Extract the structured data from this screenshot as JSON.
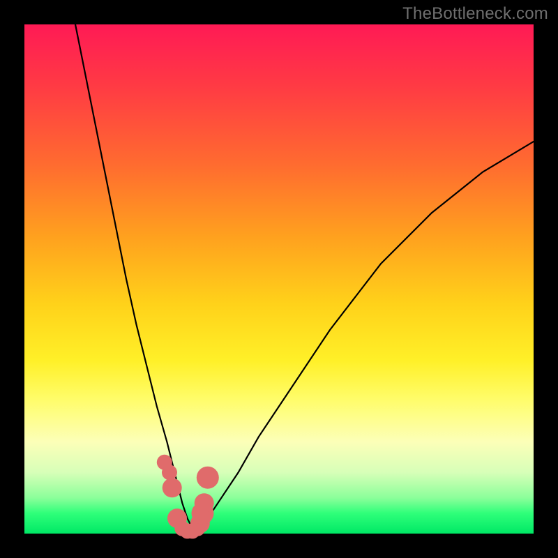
{
  "watermark": "TheBottleneck.com",
  "chart_data": {
    "type": "line",
    "title": "",
    "xlabel": "",
    "ylabel": "",
    "xlim": [
      0,
      100
    ],
    "ylim": [
      0,
      100
    ],
    "series": [
      {
        "name": "bottleneck-curve",
        "x": [
          10,
          12,
          14,
          16,
          18,
          20,
          22,
          24,
          26,
          28,
          30,
          31,
          32,
          33,
          34,
          36,
          38,
          42,
          46,
          52,
          60,
          70,
          80,
          90,
          100
        ],
        "y": [
          100,
          90,
          80,
          70,
          60,
          50,
          41,
          33,
          25,
          18,
          10,
          6,
          3,
          1,
          1,
          3,
          6,
          12,
          19,
          28,
          40,
          53,
          63,
          71,
          77
        ]
      }
    ],
    "markers": {
      "name": "highlight-points",
      "color": "#e06b6b",
      "x": [
        27.5,
        28.5,
        29.0,
        30.0,
        31.0,
        32.0,
        33.0,
        34.0,
        34.5,
        35.0,
        35.3,
        36.0
      ],
      "y": [
        14.0,
        12.0,
        9.0,
        3.0,
        1.0,
        0.5,
        0.5,
        1.0,
        2.0,
        4.0,
        6.0,
        11.0
      ],
      "size": [
        11,
        11,
        14,
        14,
        11,
        11,
        11,
        11,
        14,
        16,
        14,
        16
      ]
    },
    "background_gradient": {
      "top": "#ff1a55",
      "mid": "#fff028",
      "bottom": "#00e865"
    }
  }
}
